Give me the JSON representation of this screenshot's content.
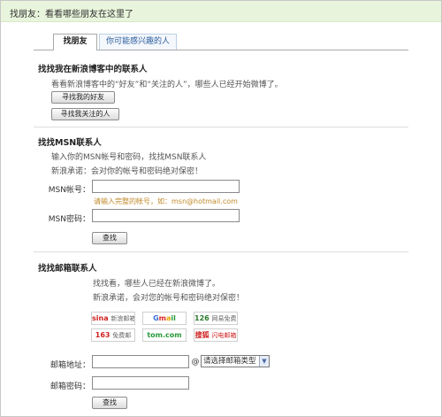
{
  "header": {
    "title": "找朋友：看看哪些朋友在这里了"
  },
  "tabs": [
    {
      "label": "找朋友"
    },
    {
      "label": "你可能感兴趣的人"
    }
  ],
  "blog_section": {
    "title": "找找我在新浪博客中的联系人",
    "desc": "看看新浪博客中的“好友”和“关注的人”，哪些人已经开始微博了。",
    "btn_friends": "寻找我的好友",
    "btn_following": "寻找我关注的人"
  },
  "msn_section": {
    "title": "找找MSN联系人",
    "desc1": "输入你的MSN帐号和密码，找找MSN联系人",
    "desc2": "新浪承诺：会对你的帐号和密码绝对保密！",
    "account_label": "MSN帐号：",
    "account_value": "",
    "hint": "请输入完整的帐号，如：msn@hotmail.com",
    "password_label": "MSN密码：",
    "password_value": "",
    "search_btn": "查找"
  },
  "mail_section": {
    "title": "找找邮箱联系人",
    "desc1": "找找看，哪些人已经在新浪微博了。",
    "desc2": "新浪承诺，会对您的帐号和密码绝对保密！",
    "providers": {
      "sina": {
        "main": "sina",
        "sub": "新浪邮箱"
      },
      "gmail": {
        "g1": "G",
        "g2": "m",
        "g3": "a",
        "g4": "il"
      },
      "m126": {
        "main": "126",
        "sub": "网易免费邮"
      },
      "m163": {
        "main": "163",
        "sub": "免费邮"
      },
      "tom": {
        "main": "tom.com"
      },
      "sohu": {
        "main": "搜狐",
        "sub": "闪电邮箱"
      }
    },
    "address_label": "邮箱地址：",
    "address_value": "",
    "at": "@",
    "domain_select": "请选择邮箱类型",
    "password_label": "邮箱密码：",
    "password_value": "",
    "search_btn": "查找"
  },
  "colors": {
    "header_bg": "#e8f5dc",
    "link_blue": "#2c5ea0",
    "hint_orange": "#c08a2a"
  }
}
